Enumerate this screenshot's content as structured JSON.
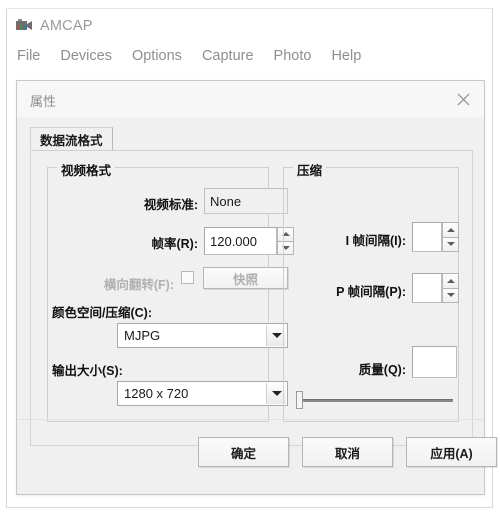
{
  "app": {
    "title": "AMCAP",
    "icon": "camcorder-icon",
    "menu": [
      {
        "label": "File"
      },
      {
        "label": "Devices"
      },
      {
        "label": "Options"
      },
      {
        "label": "Capture"
      },
      {
        "label": "Photo"
      },
      {
        "label": "Help"
      }
    ]
  },
  "dialog": {
    "title": "属性",
    "close_icon": "close-icon",
    "tabs": [
      {
        "label": "数据流格式",
        "selected": true
      }
    ],
    "video_group": {
      "legend": "视频格式",
      "video_standard": {
        "label": "视频标准:",
        "value": "None"
      },
      "frame_rate": {
        "label": "帧率(R):",
        "value": "120.000",
        "spin_up_icon": "chevron-up-icon",
        "spin_down_icon": "chevron-down-icon"
      },
      "flip_horizontal": {
        "label": "横向翻转(F):",
        "checked": false,
        "disabled": true
      },
      "snapshot_button": {
        "label": "快照",
        "disabled": true
      },
      "color_space": {
        "label": "颜色空间/压缩(C):",
        "value": "MJPG",
        "arrow_icon": "chevron-down-icon"
      },
      "output_size": {
        "label": "输出大小(S):",
        "value": "1280 x 720",
        "arrow_icon": "chevron-down-icon"
      }
    },
    "compression_group": {
      "legend": "压缩",
      "i_frame_interval": {
        "label": "I 帧间隔(I):",
        "value": "",
        "spin_up_icon": "chevron-up-icon",
        "spin_down_icon": "chevron-down-icon"
      },
      "p_frame_interval": {
        "label": "P 帧间隔(P):",
        "value": "",
        "spin_up_icon": "chevron-up-icon",
        "spin_down_icon": "chevron-down-icon"
      },
      "quality": {
        "label": "质量(Q):",
        "value": "",
        "slider_position_percent": 0
      }
    },
    "footer": {
      "ok": "确定",
      "cancel": "取消",
      "apply": "应用(A)"
    }
  },
  "colors": {
    "dialog_bg": "#f0f0f0",
    "text": "#111111",
    "muted_text": "#8e8e8e",
    "disabled_text": "#b0b0b0",
    "border": "#cfcfcf"
  }
}
